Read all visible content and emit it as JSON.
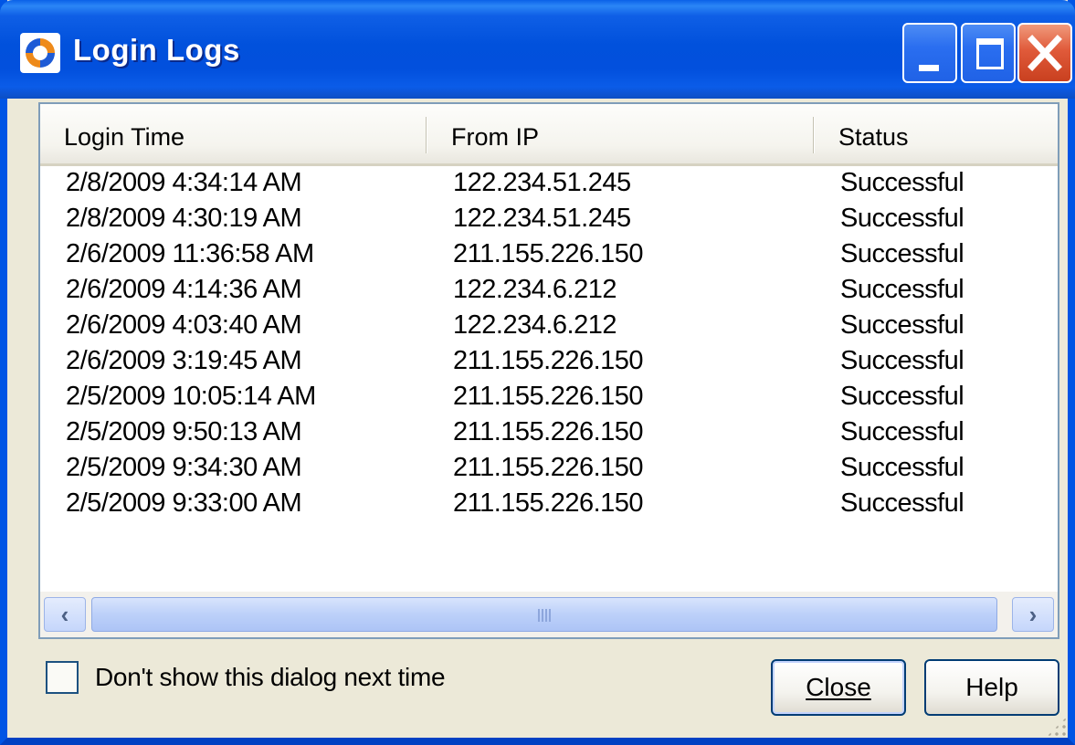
{
  "window": {
    "title": "Login Logs",
    "controls": {
      "minimize": "minimize",
      "maximize": "maximize",
      "close": "close"
    }
  },
  "columns": [
    "Login Time",
    "From IP",
    "Status"
  ],
  "rows": [
    {
      "time": "2/8/2009 4:34:14 AM",
      "ip": "122.234.51.245",
      "status": "Successful"
    },
    {
      "time": "2/8/2009 4:30:19 AM",
      "ip": "122.234.51.245",
      "status": "Successful"
    },
    {
      "time": "2/6/2009 11:36:58 AM",
      "ip": "211.155.226.150",
      "status": "Successful"
    },
    {
      "time": "2/6/2009 4:14:36 AM",
      "ip": "122.234.6.212",
      "status": "Successful"
    },
    {
      "time": "2/6/2009 4:03:40 AM",
      "ip": "122.234.6.212",
      "status": "Successful"
    },
    {
      "time": "2/6/2009 3:19:45 AM",
      "ip": "211.155.226.150",
      "status": "Successful"
    },
    {
      "time": "2/5/2009 10:05:14 AM",
      "ip": "211.155.226.150",
      "status": "Successful"
    },
    {
      "time": "2/5/2009 9:50:13 AM",
      "ip": "211.155.226.150",
      "status": "Successful"
    },
    {
      "time": "2/5/2009 9:34:30 AM",
      "ip": "211.155.226.150",
      "status": "Successful"
    },
    {
      "time": "2/5/2009 9:33:00 AM",
      "ip": "211.155.226.150",
      "status": "Successful"
    }
  ],
  "footer": {
    "checkbox_label": "Don't show this dialog next time",
    "checkbox_checked": false,
    "close_label": "Close",
    "help_label": "Help"
  },
  "colors": {
    "titlebar": "#0151dc",
    "close_button": "#e05a3a",
    "dialog_background": "#ece9d8"
  }
}
